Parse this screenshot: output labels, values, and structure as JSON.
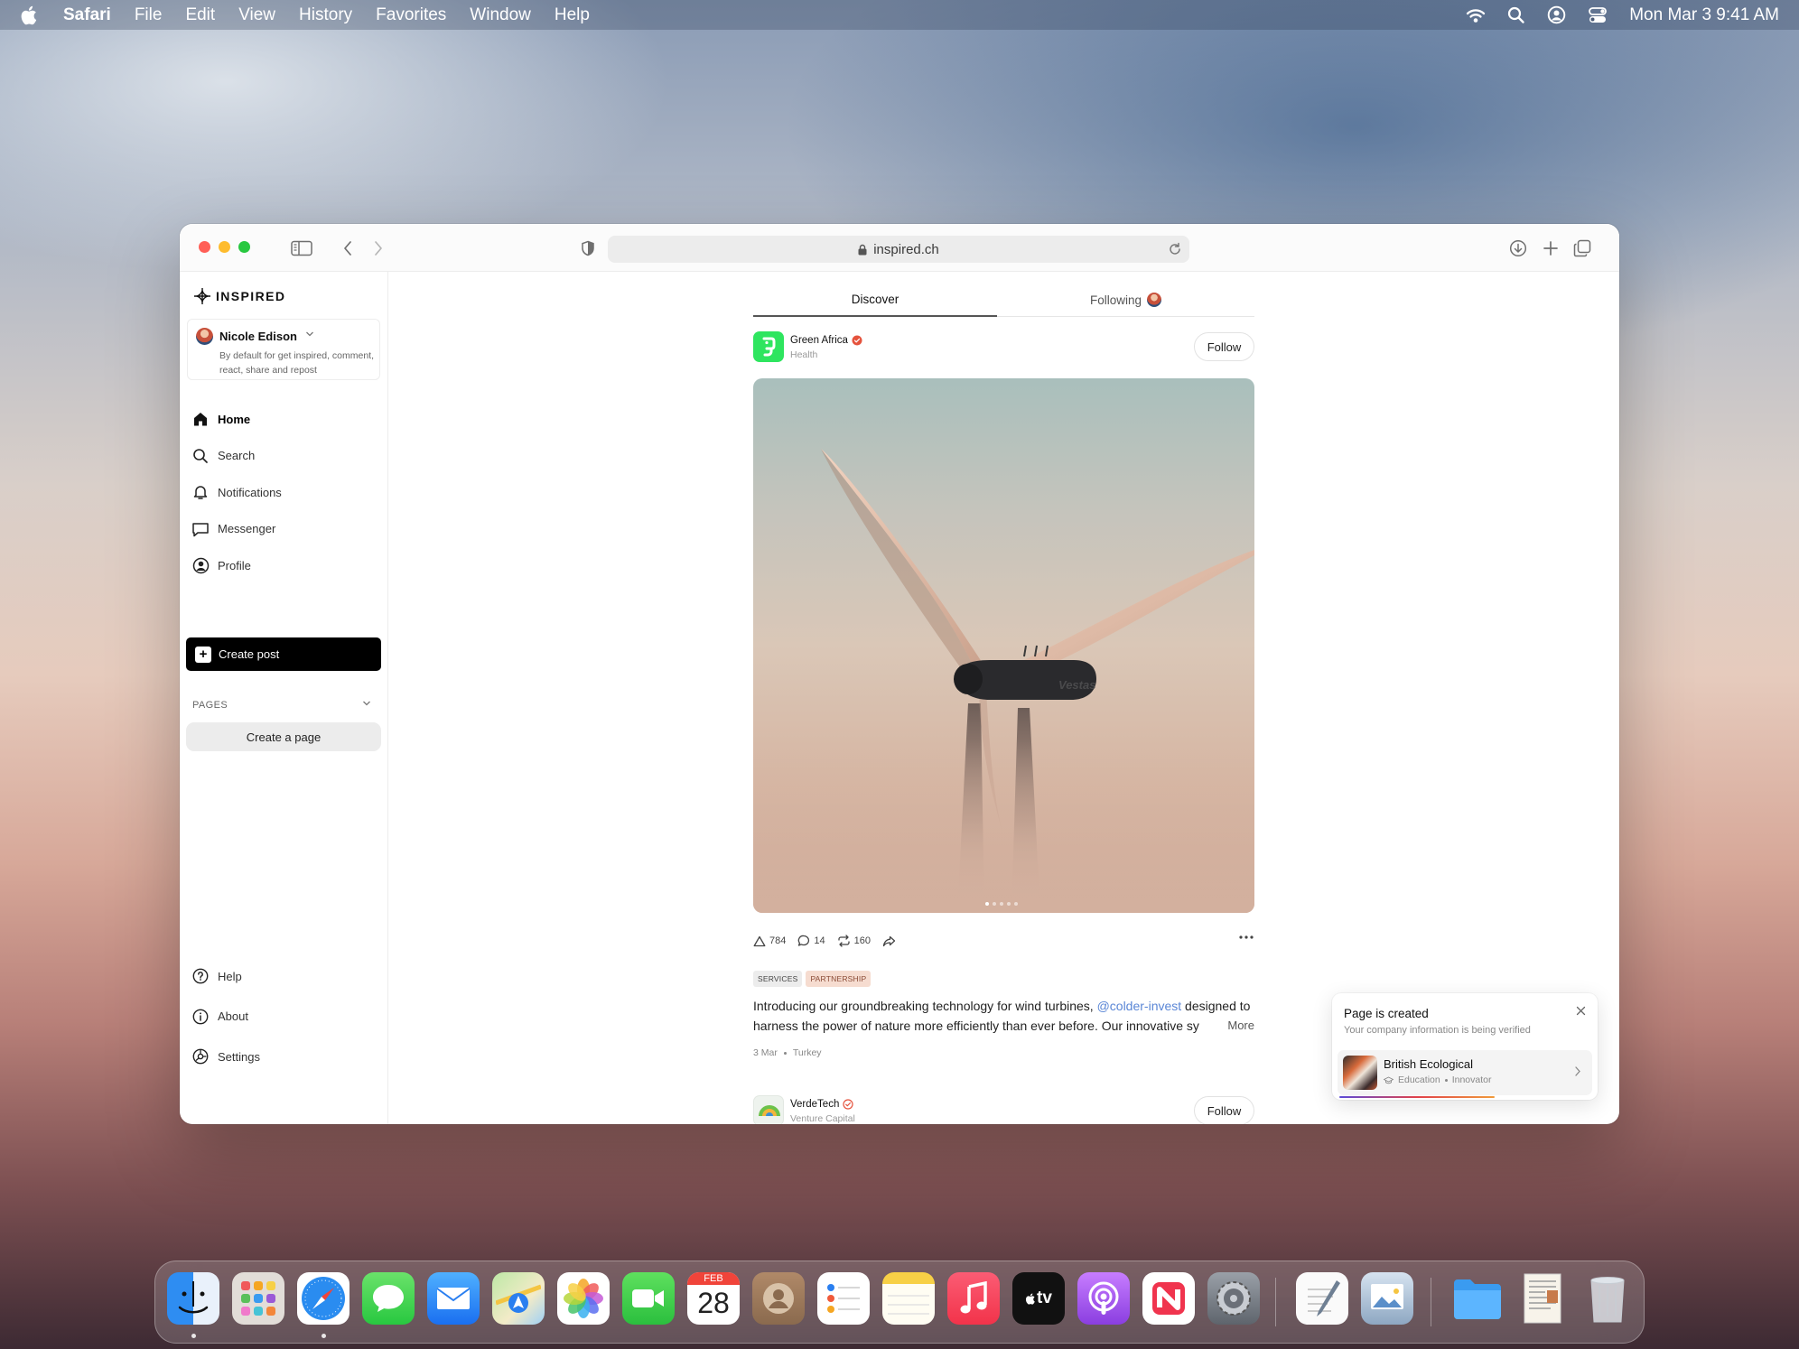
{
  "menubar": {
    "app": "Safari",
    "items": [
      "File",
      "Edit",
      "View",
      "History",
      "Favorites",
      "Window",
      "Help"
    ],
    "clock": "Mon  Mar 3  9:41 AM",
    "status_icons": [
      "wifi-icon",
      "spotlight-search-icon",
      "user-account-icon",
      "control-center-icon"
    ]
  },
  "browser": {
    "url": "inspired.ch",
    "toolbar_icons": [
      "sidebar-toggle-icon",
      "back-icon",
      "forward-icon",
      "shield-icon",
      "lock-icon",
      "reload-icon",
      "download-icon",
      "new-tab-icon",
      "tab-overview-icon"
    ]
  },
  "sidebar": {
    "logo": "INSPIRED",
    "account": {
      "name": "Nicole Edison",
      "description": "By default for get inspired, comment, react, share and repost"
    },
    "nav": [
      {
        "label": "Home",
        "icon": "home-icon",
        "active": true
      },
      {
        "label": "Search",
        "icon": "search-icon"
      },
      {
        "label": "Notifications",
        "icon": "bell-icon"
      },
      {
        "label": "Messenger",
        "icon": "chat-bubble-icon"
      },
      {
        "label": "Profile",
        "icon": "user-circle-icon"
      }
    ],
    "create_post": "Create post",
    "pages_label": "PAGES",
    "create_page": "Create a page",
    "bottom_nav": [
      {
        "label": "Help",
        "icon": "help-icon"
      },
      {
        "label": "About",
        "icon": "info-icon"
      },
      {
        "label": "Settings",
        "icon": "settings-icon"
      }
    ]
  },
  "feed": {
    "tabs": [
      {
        "label": "Discover",
        "active": true
      },
      {
        "label": "Following"
      }
    ],
    "post": {
      "author": "Green Africa",
      "category": "Health",
      "follow": "Follow",
      "carousel": {
        "count": 5,
        "current": 1
      },
      "likes": "784",
      "comments": "14",
      "reposts": "160",
      "tags": [
        "SERVICES",
        "PARTNERSHIP"
      ],
      "text_before": "Introducing our groundbreaking technology for wind turbines, ",
      "mention": "@colder-invest",
      "text_after": " designed to harness the power of nature more efficiently than ever before. Our innovative sy",
      "more": "More",
      "date": "3 Mar",
      "location": "Turkey"
    },
    "next_post": {
      "author": "VerdeTech",
      "category": "Venture Capital",
      "follow": "Follow"
    }
  },
  "toast": {
    "title": "Page is created",
    "subtitle": "Your company information is being verified",
    "page_name": "British Ecological",
    "page_category": "Education",
    "page_type": "Innovator"
  },
  "dock": {
    "apps": [
      "Finder",
      "Launchpad",
      "Safari",
      "Messages",
      "Mail",
      "Maps",
      "Photos",
      "FaceTime",
      "Calendar",
      "Contacts",
      "Reminders",
      "Notes",
      "Music",
      "TV",
      "Podcasts",
      "News",
      "System Settings",
      "TextEdit",
      "Preview",
      "Downloads",
      "Documents",
      "Trash"
    ],
    "calendar_month": "FEB",
    "calendar_day": "28",
    "tv_label": "tv"
  }
}
